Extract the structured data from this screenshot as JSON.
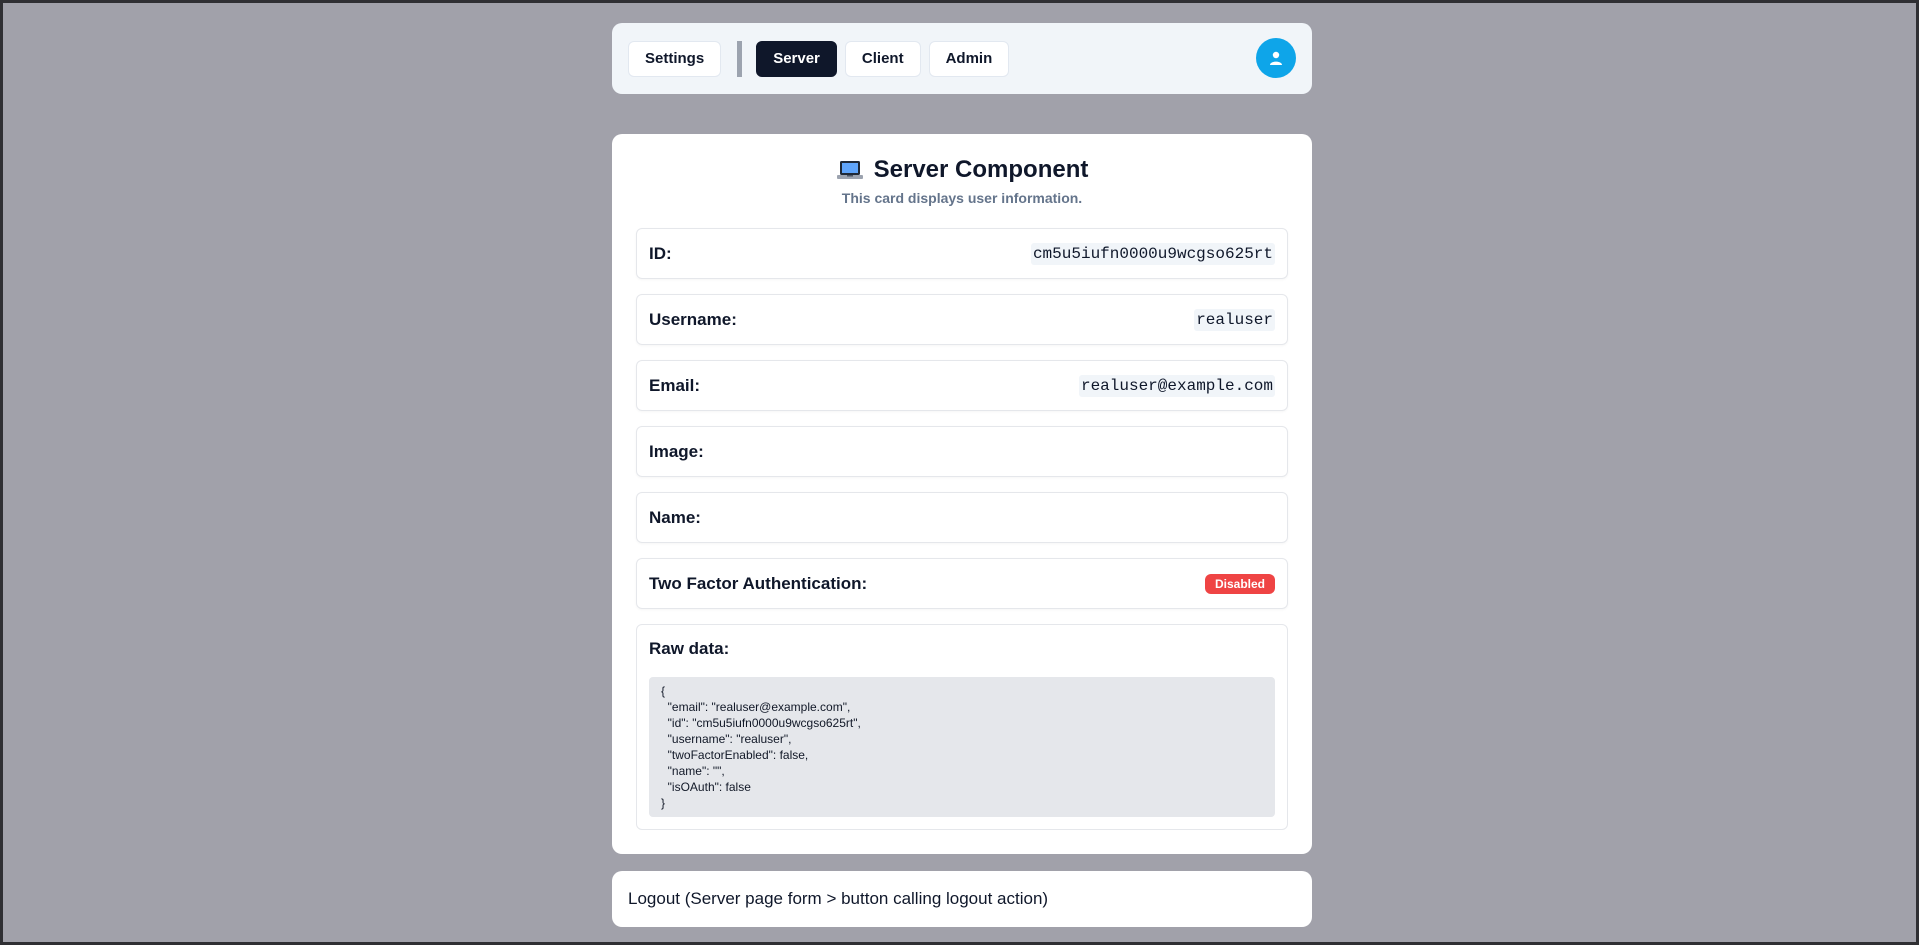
{
  "nav": {
    "settings_label": "Settings",
    "server_label": "Server",
    "client_label": "Client",
    "admin_label": "Admin",
    "active_tab": "Server",
    "avatar_icon": "user-icon",
    "avatar_color": "#0ea5e9"
  },
  "card": {
    "icon": "laptop-icon",
    "title": "Server Component",
    "subtitle": "This card displays user information.",
    "fields": {
      "id_label": "ID:",
      "id_value": "cm5u5iufn0000u9wcgso625rt",
      "username_label": "Username:",
      "username_value": "realuser",
      "email_label": "Email:",
      "email_value": "realuser@example.com",
      "image_label": "Image:",
      "image_value": "",
      "name_label": "Name:",
      "name_value": "",
      "twofa_label": "Two Factor Authentication:",
      "twofa_badge": "Disabled",
      "twofa_badge_color": "#ef4444"
    },
    "raw_label": "Raw data:",
    "raw_json": "{\n  \"email\": \"realuser@example.com\",\n  \"id\": \"cm5u5iufn0000u9wcgso625rt\",\n  \"username\": \"realuser\",\n  \"twoFactorEnabled\": false,\n  \"name\": \"\",\n  \"isOAuth\": false\n}"
  },
  "logout": {
    "label": "Logout (Server page form > button calling logout action)"
  }
}
